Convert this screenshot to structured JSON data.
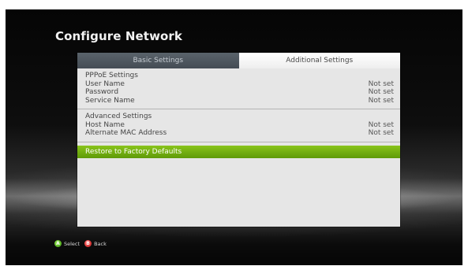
{
  "screen": {
    "title": "Configure Network"
  },
  "tabs": [
    {
      "label": "Basic Settings",
      "selected": false
    },
    {
      "label": "Additional Settings",
      "selected": true
    }
  ],
  "pppoe": {
    "heading": "PPPoE Settings",
    "rows": [
      {
        "label": "User Name",
        "value": "Not set"
      },
      {
        "label": "Password",
        "value": "Not set"
      },
      {
        "label": "Service Name",
        "value": "Not set"
      }
    ]
  },
  "advanced": {
    "heading": "Advanced Settings",
    "rows": [
      {
        "label": "Host Name",
        "value": "Not set"
      },
      {
        "label": "Alternate MAC Address",
        "value": "Not set"
      }
    ]
  },
  "restore": {
    "label": "Restore to Factory Defaults"
  },
  "hints": {
    "select_glyph": "A",
    "select_label": "Select",
    "back_glyph": "B",
    "back_label": "Back"
  },
  "colors": {
    "accent_green": "#6fae10",
    "tab_dark": "#4c545c",
    "panel_bg": "#e6e6e6"
  }
}
